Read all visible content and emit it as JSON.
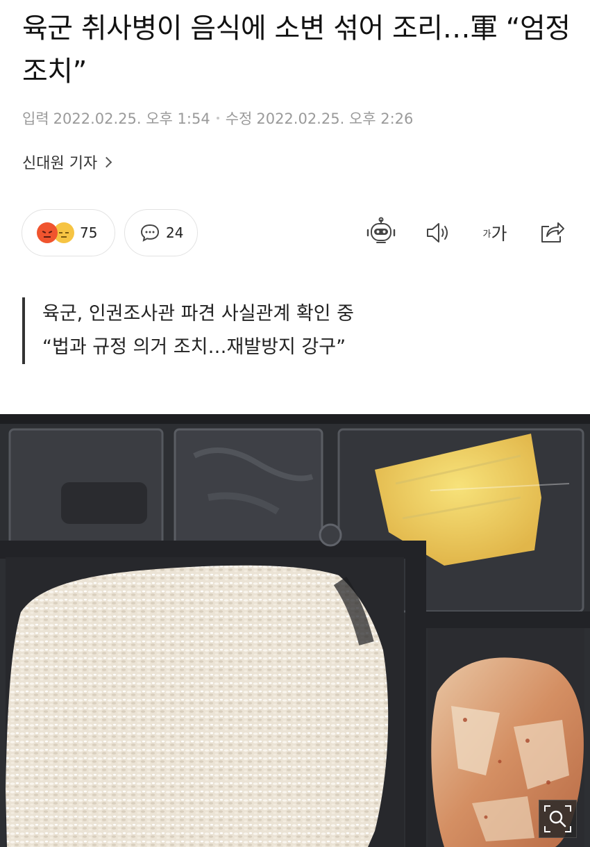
{
  "article": {
    "title": "육군 취사병이 음식에 소변 섞어 조리…軍 “엄정 조치”",
    "input_label": "입력",
    "input_datetime": "2022.02.25. 오후 1:54",
    "modified_label": "수정",
    "modified_datetime": "2022.02.25. 오후 2:26",
    "reporter": "신대원 기자"
  },
  "reactions": {
    "count": "75"
  },
  "comments": {
    "count": "24"
  },
  "toolbar": {
    "font_small": "가",
    "font_big": "가"
  },
  "summary": {
    "lines": [
      "육군, 인권조사관 파견 사실관계 확인 중",
      "“법과 규정 의거 조치…재발방지 강구”"
    ]
  },
  "icons": {
    "reaction_1": "angry-face-icon",
    "reaction_2": "sad-face-icon",
    "comment": "speech-bubble-icon",
    "summary_bot": "robot-icon",
    "read_aloud": "speaker-icon",
    "share": "share-icon",
    "zoom": "magnifier-icon"
  },
  "colors": {
    "angry": "#f0542e",
    "sad": "#f6c443",
    "meta_text": "#9a9a9a"
  }
}
